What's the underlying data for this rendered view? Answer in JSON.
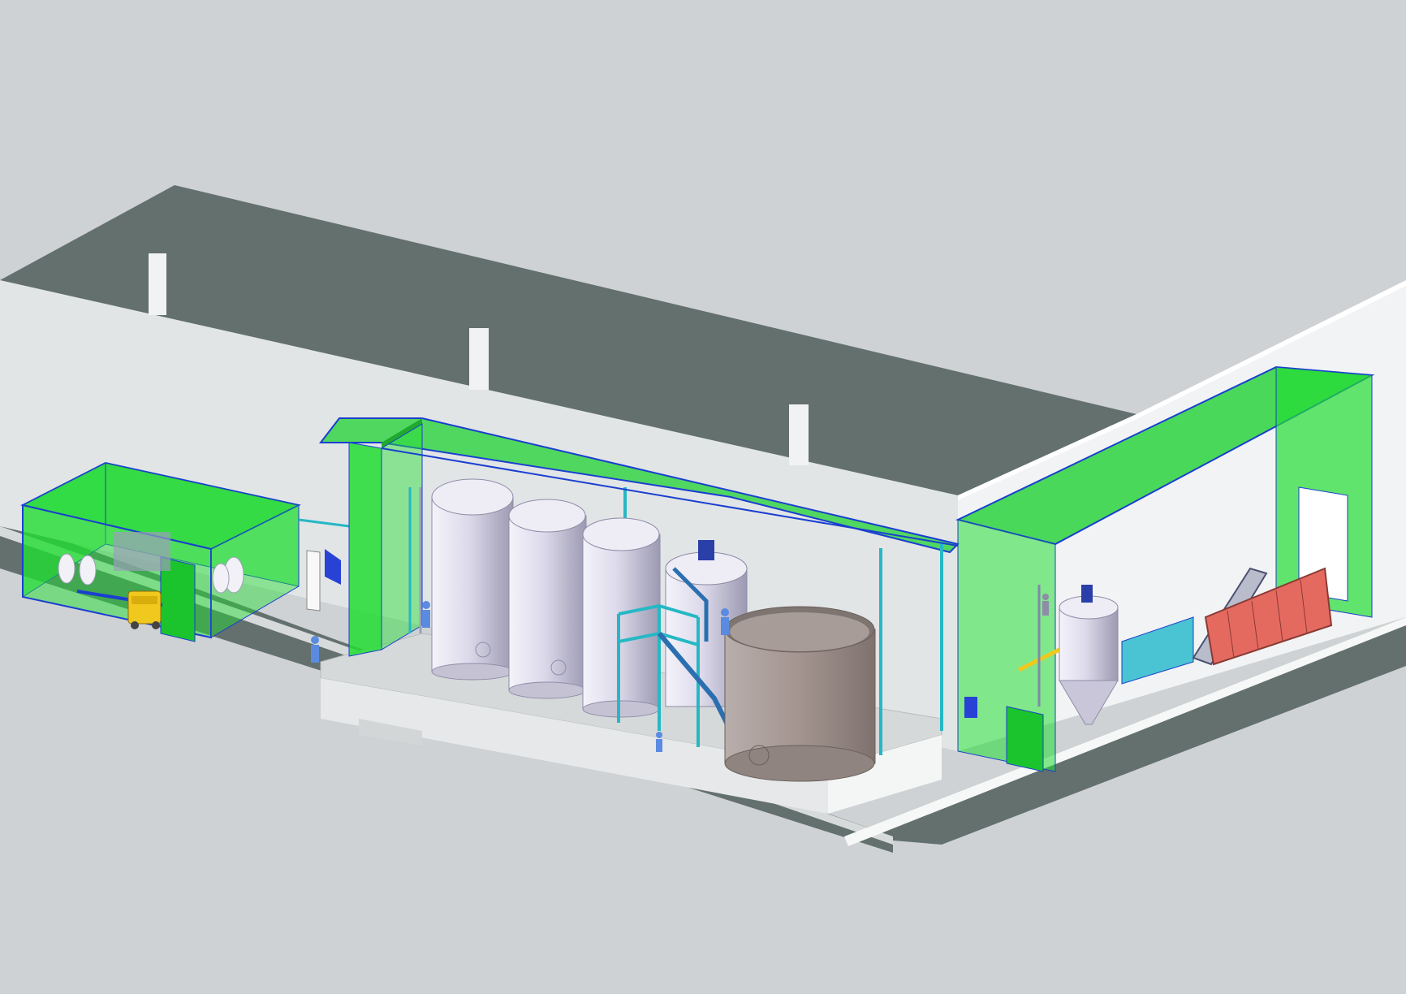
{
  "scene": {
    "kind": "isometric-3d-plant-layout",
    "colors": {
      "background": "#cfd2d4",
      "roof": "#63706e",
      "wall_light": "#eceeef",
      "wall_mid": "#d8dbdd",
      "floor_slab": "#dfe2e3",
      "enclosure_green": "#22dd33",
      "enclosure_edge": "#1a3fd0",
      "pipe_cyan": "#25b8c4",
      "steel_tank": "#d6d4e4",
      "steel_tank_shadow": "#a9a7bd",
      "big_tank": "#a59a96",
      "dumpster_red": "#e46a60",
      "cart_yellow": "#f0c81e",
      "operator_blue": "#5a8be0"
    },
    "components": [
      "building-shell",
      "left-enclosure",
      "central-canopy",
      "tank-bank",
      "access-platform",
      "large-open-tank",
      "right-canopy",
      "conical-tank",
      "inclined-conveyor",
      "red-container",
      "yellow-cart",
      "operators"
    ],
    "tank_count": 4
  }
}
